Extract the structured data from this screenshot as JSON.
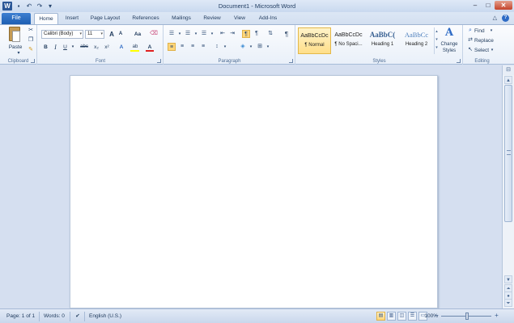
{
  "titlebar": {
    "title": "Document1 - Microsoft Word",
    "logo_letter": "W",
    "qat_icons": [
      "save-icon",
      "undo-icon",
      "redo-icon",
      "customize-qat-icon"
    ]
  },
  "tabs": {
    "file": "File",
    "items": [
      "Home",
      "Insert",
      "Page Layout",
      "References",
      "Mailings",
      "Review",
      "View",
      "Add-Ins"
    ],
    "active": "Home"
  },
  "ribbon": {
    "clipboard": {
      "label": "Clipboard",
      "paste": "Paste"
    },
    "font": {
      "label": "Font",
      "font_name": "Calibri (Body)",
      "font_size": "11",
      "bold": "B",
      "italic": "I",
      "underline": "U",
      "strike": "abc",
      "subscript": "x₂",
      "superscript": "x²",
      "grow": "A",
      "shrink": "A",
      "change_case": "Aa",
      "font_color": "A",
      "highlight": "ab"
    },
    "paragraph": {
      "label": "Paragraph",
      "pilcrow": "¶"
    },
    "styles": {
      "label": "Styles",
      "items": [
        {
          "sample": "AaBbCcDc",
          "name": "¶ Normal",
          "selected": true
        },
        {
          "sample": "AaBbCcDc",
          "name": "¶ No Spaci...",
          "selected": false
        },
        {
          "sample": "AaBbC(",
          "name": "Heading 1",
          "selected": false
        },
        {
          "sample": "AaBbCc",
          "name": "Heading 2",
          "selected": false
        }
      ],
      "change_styles": "Change Styles"
    },
    "editing": {
      "label": "Editing",
      "find": "Find",
      "replace": "Replace",
      "select": "Select"
    }
  },
  "statusbar": {
    "page": "Page: 1 of 1",
    "words": "Words: 0",
    "language": "English (U.S.)",
    "zoom": "100%"
  },
  "colors": {
    "file_tab": "#2a6ac0",
    "selected_style": "#ffe08f",
    "font_color_bar": "#e02020",
    "highlight_bar": "#ffff00"
  }
}
